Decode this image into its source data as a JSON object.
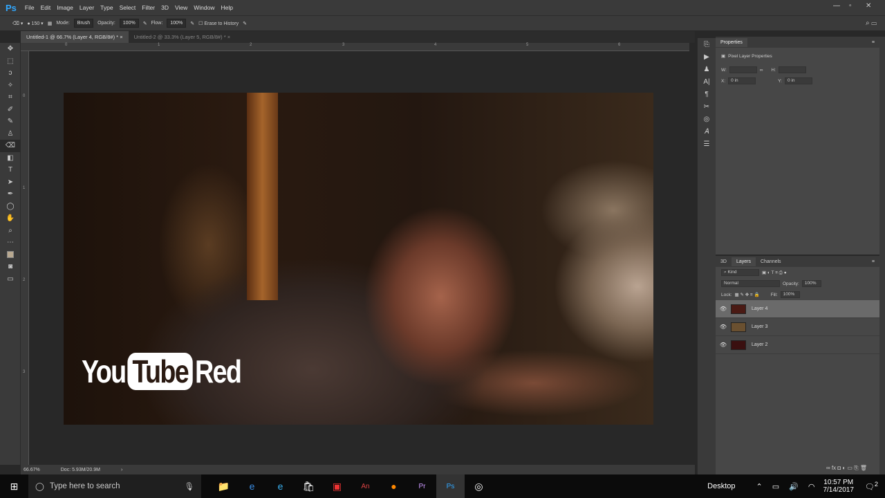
{
  "app": {
    "logo": "Ps",
    "menu": [
      "File",
      "Edit",
      "Image",
      "Layer",
      "Type",
      "Select",
      "Filter",
      "3D",
      "View",
      "Window",
      "Help"
    ]
  },
  "options": {
    "brush_size": "150",
    "mode_label": "Mode:",
    "mode_value": "Brush",
    "opacity_label": "Opacity:",
    "opacity_value": "100%",
    "flow_label": "Flow:",
    "flow_value": "100%",
    "erase_history": "Erase to History"
  },
  "tabs": [
    {
      "label": "Untitled-1 @ 66.7% (Layer 4, RGB/8#) *"
    },
    {
      "label": "Untitled-2 @ 33.3% (Layer 5, RGB/8#) *"
    }
  ],
  "rulers": {
    "top": [
      "0",
      "1",
      "2",
      "3",
      "4",
      "5",
      "6"
    ],
    "left": [
      "0",
      "1",
      "2",
      "3"
    ]
  },
  "canvas": {
    "logo_you": "You",
    "logo_tube": "Tube",
    "logo_red": "Red"
  },
  "status": {
    "zoom": "66.67%",
    "doc": "Doc: 5.93M/20.9M"
  },
  "properties": {
    "title": "Properties",
    "subtitle": "Pixel Layer Properties",
    "w_label": "W:",
    "h_label": "H:",
    "x_label": "X:",
    "x_value": "0 in",
    "y_label": "Y:",
    "y_value": "0 in"
  },
  "layers_panel": {
    "tabs": [
      "3D",
      "Layers",
      "Channels"
    ],
    "filter": "Kind",
    "blend": "Normal",
    "opacity_label": "Opacity:",
    "opacity": "100%",
    "lock_label": "Lock:",
    "fill_label": "Fill:",
    "fill": "100%",
    "layers": [
      {
        "name": "Layer 4",
        "color": "#4a1a14"
      },
      {
        "name": "Layer 3",
        "color": "#6a5030"
      },
      {
        "name": "Layer 2",
        "color": "#3a1010"
      }
    ]
  },
  "taskbar": {
    "search": "Type here to search",
    "desktop": "Desktop",
    "time": "10:57 PM",
    "date": "7/14/2017",
    "notifications": "2"
  }
}
